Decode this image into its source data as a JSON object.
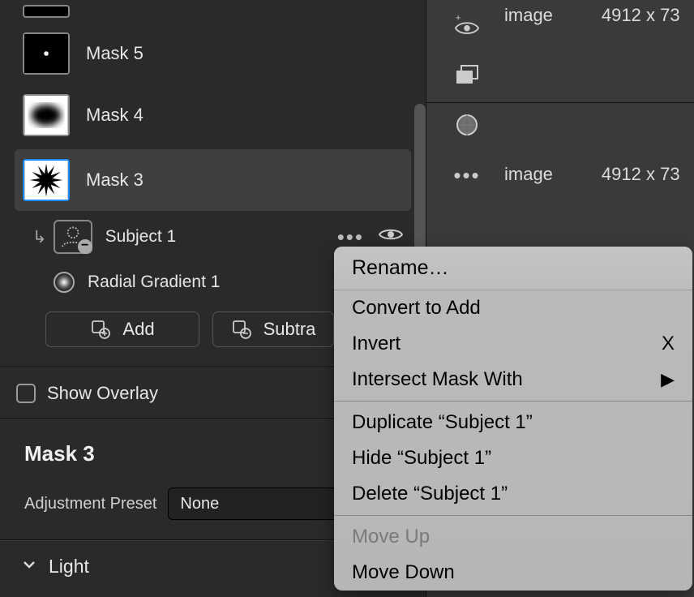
{
  "masks": [
    {
      "label": "Mask 5",
      "thumb": "dot"
    },
    {
      "label": "Mask 4",
      "thumb": "blur"
    },
    {
      "label": "Mask 3",
      "thumb": "burst",
      "selected": true
    }
  ],
  "subjects": {
    "subject_label": "Subject 1",
    "gradient_label": "Radial Gradient 1"
  },
  "buttons": {
    "add": "Add",
    "subtract": "Subtra"
  },
  "overlay_label": "Show Overlay",
  "mask_detail": {
    "title": "Mask 3",
    "preset_label": "Adjustment Preset",
    "preset_value": "None"
  },
  "light_label": "Light",
  "right_items": [
    {
      "label": "image",
      "dims": "4912 x 73"
    },
    {
      "label": "image",
      "dims": "4912 x 73"
    }
  ],
  "context_menu": {
    "rename": "Rename…",
    "convert": "Convert to Add",
    "invert": "Invert",
    "invert_shortcut": "X",
    "intersect": "Intersect Mask With",
    "duplicate": "Duplicate “Subject 1”",
    "hide": "Hide “Subject 1”",
    "delete": "Delete “Subject 1”",
    "moveup": "Move Up",
    "movedown": "Move Down"
  }
}
